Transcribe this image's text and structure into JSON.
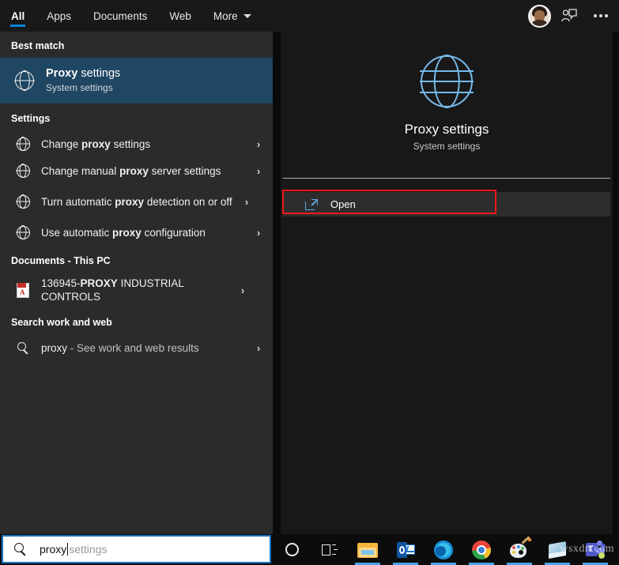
{
  "tabs": [
    {
      "label": "All",
      "active": true
    },
    {
      "label": "Apps",
      "active": false
    },
    {
      "label": "Documents",
      "active": false
    },
    {
      "label": "Web",
      "active": false
    },
    {
      "label": "More",
      "active": false,
      "has_caret": true
    }
  ],
  "header": {
    "avatar_name": "user-avatar",
    "feedback_icon": "person-chat-icon",
    "more_icon": "ellipsis-icon"
  },
  "sections": {
    "best_match_head": "Best match",
    "settings_head": "Settings",
    "documents_head": "Documents - This PC",
    "web_head": "Search work and web"
  },
  "best_match": {
    "title_bold": "Proxy",
    "title_rest": " settings",
    "subtitle": "System settings",
    "icon": "globe-icon"
  },
  "settings_items": [
    {
      "pre": "Change ",
      "bold": "proxy",
      "post": " settings",
      "icon": "globe-icon",
      "chevron": "›"
    },
    {
      "pre": "Change manual ",
      "bold": "proxy",
      "post": " server settings",
      "icon": "globe-icon",
      "chevron": "›"
    },
    {
      "pre": "Turn automatic ",
      "bold": "proxy",
      "post": " detection on or off",
      "icon": "globe-icon",
      "chevron": "›"
    },
    {
      "pre": "Use automatic ",
      "bold": "proxy",
      "post": " configuration",
      "icon": "globe-icon",
      "chevron": "›"
    }
  ],
  "documents_items": [
    {
      "pre": "136945-",
      "bold": "PROXY",
      "post": " INDUSTRIAL CONTROLS",
      "icon": "pdf-file-icon",
      "chevron": "›"
    }
  ],
  "web_items": [
    {
      "pre": "proxy",
      "bold": "",
      "post": " - See work and web results",
      "icon": "search-icon",
      "chevron": "›"
    }
  ],
  "preview": {
    "icon": "globe-icon-large",
    "title": "Proxy settings",
    "subtitle": "System settings",
    "open_label": "Open",
    "open_icon": "open-external-icon",
    "highlight_color": "#f01818"
  },
  "searchbox": {
    "typed_value": "proxy",
    "suggestion_suffix": " settings",
    "icon": "search-icon",
    "border_color": "#1a73c0"
  },
  "taskbar": {
    "items": [
      {
        "name": "cortana-icon",
        "running": false
      },
      {
        "name": "task-view-icon",
        "running": false
      },
      {
        "name": "file-explorer-icon",
        "running": true
      },
      {
        "name": "outlook-icon",
        "running": true
      },
      {
        "name": "edge-icon",
        "running": true
      },
      {
        "name": "chrome-icon",
        "running": true
      },
      {
        "name": "paint-icon",
        "running": true
      },
      {
        "name": "sticky-notes-icon",
        "running": true
      },
      {
        "name": "teams-icon",
        "running": true
      }
    ]
  },
  "watermark": "wsxdn.com",
  "colors": {
    "accent": "#0a84d8",
    "selected_row": "#1f4662",
    "left_panel": "#2b2b2b",
    "right_panel": "#181818",
    "tabbar": "#191919"
  }
}
